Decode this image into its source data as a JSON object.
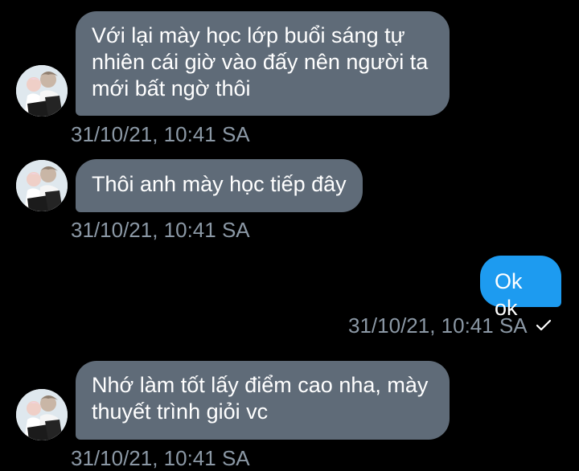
{
  "colors": {
    "background": "#000000",
    "incoming_bubble": "#5f6b78",
    "outgoing_bubble": "#1d9bf0",
    "timestamp": "#8b98a5"
  },
  "messages": [
    {
      "direction": "incoming",
      "avatar": "user-avatar",
      "text": "Với lại mày học lớp buổi sáng tự nhiên cái giờ vào đấy nên người ta mới bất ngờ thôi",
      "time": "31/10/21, 10:41 SA"
    },
    {
      "direction": "incoming",
      "avatar": "user-avatar",
      "text": "Thôi anh mày học tiếp đây",
      "time": "31/10/21, 10:41 SA"
    },
    {
      "direction": "outgoing",
      "text": "Ok ok",
      "time": "31/10/21, 10:41 SA",
      "status_icon": "check-icon"
    },
    {
      "direction": "incoming",
      "avatar": "user-avatar",
      "text": "Nhớ làm tốt lấy điểm cao nha, mày thuyết trình giỏi vc",
      "time": "31/10/21, 10:41 SA"
    }
  ]
}
